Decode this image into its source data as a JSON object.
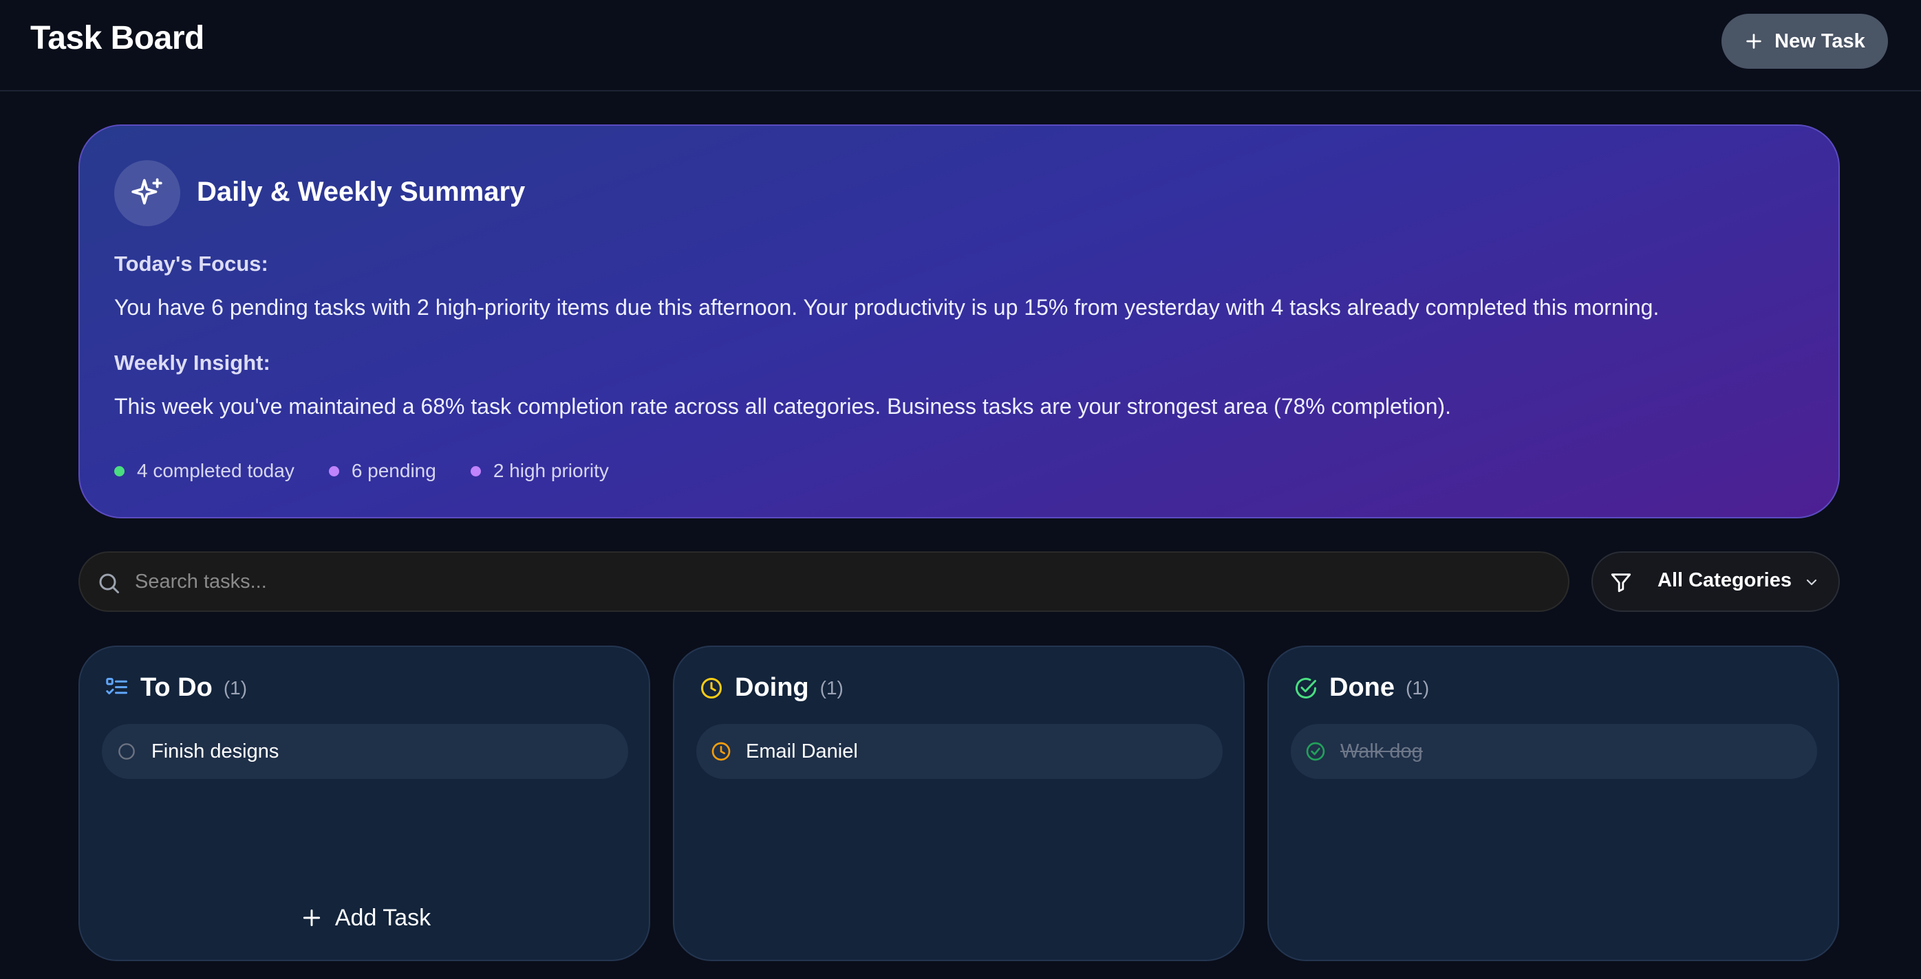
{
  "header": {
    "title": "Task Board",
    "new_task_label": "New Task",
    "new_task_icon": "plus-icon"
  },
  "summary": {
    "icon": "sparkles-icon",
    "title": "Daily & Weekly Summary",
    "focus_label": "Today's Focus:",
    "focus_text": "You have 6 pending tasks with 2 high-priority items due this afternoon. Your productivity is up 15% from yesterday with 4 tasks already completed this morning.",
    "insight_label": "Weekly Insight:",
    "insight_text": "This week you've maintained a 68% task completion rate across all categories. Business tasks are your strongest area (78% completion).",
    "stats": [
      {
        "label": "4 completed today",
        "color": "#4ade80"
      },
      {
        "label": "6 pending",
        "color": "#c084fc"
      },
      {
        "label": "2 high priority",
        "color": "#c084fc"
      }
    ]
  },
  "search": {
    "placeholder": "Search tasks...",
    "value": ""
  },
  "filter": {
    "selected": "All Categories"
  },
  "columns": [
    {
      "title": "To Do",
      "count": "(1)",
      "icon": "list-checks-icon",
      "accent": "#60a5fa",
      "tasks": [
        {
          "label": "Finish designs",
          "status": "todo"
        }
      ],
      "add_label": "Add Task"
    },
    {
      "title": "Doing",
      "count": "(1)",
      "icon": "clock-icon",
      "accent": "#facc15",
      "tasks": [
        {
          "label": "Email Daniel",
          "status": "doing"
        }
      ]
    },
    {
      "title": "Done",
      "count": "(1)",
      "icon": "check-circle-icon",
      "accent": "#4ade80",
      "tasks": [
        {
          "label": "Walk dog",
          "status": "done"
        }
      ]
    }
  ],
  "colors": {
    "background": "#0a0e1a",
    "column_bg": "#13243b",
    "task_bg": "#1f3049",
    "new_task_button": "#4a5566"
  }
}
